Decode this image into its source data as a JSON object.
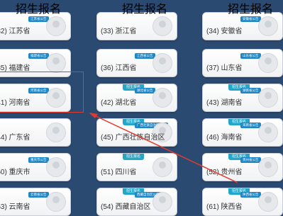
{
  "cards": [
    {
      "tag": "",
      "badge": "江苏省公告",
      "label": "(32) 江苏省"
    },
    {
      "tag": "",
      "badge": "",
      "label": "(33) 浙江省"
    },
    {
      "tag": "",
      "badge": "安徽省公告",
      "label": "(34) 安徽省"
    },
    {
      "tag": "",
      "badge": "福建省公告",
      "label": "(35) 福建省"
    },
    {
      "tag": "",
      "badge": "江西省公告",
      "label": "(36) 江西省"
    },
    {
      "tag": "",
      "badge": "山东省公告",
      "label": "(37) 山东省"
    },
    {
      "tag": "",
      "badge": "河南省公告",
      "label": "(41) 河南省"
    },
    {
      "tag": "招生报名",
      "badge": "湖北省公告",
      "label": "(42) 湖北省"
    },
    {
      "tag": "招生报名",
      "badge": "湖南省公告",
      "label": "(43) 湖南省"
    },
    {
      "tag": "",
      "badge": "",
      "label": "(44) 广东省"
    },
    {
      "tag": "招生报名",
      "badge": "广西壮族自治区公告",
      "label": "(45) 广西壮族自治区"
    },
    {
      "tag": "招生报名",
      "badge": "海南省公告",
      "label": "(46) 海南省"
    },
    {
      "tag": "",
      "badge": "重庆市公告",
      "label": "(50) 重庆市"
    },
    {
      "tag": "招生报名",
      "badge": "",
      "label": "(51) 四川省"
    },
    {
      "tag": "招生报名",
      "badge": "贵州省公告",
      "label": "(52) 贵州省"
    },
    {
      "tag": "",
      "badge": "云南省公告",
      "label": "(53) 云南省"
    },
    {
      "tag": "招生报名",
      "badge": "西藏自治区公告",
      "label": "(54) 西藏自治区"
    },
    {
      "tag": "招生报名",
      "badge": "陕西省公告",
      "label": "(61) 陕西省"
    }
  ],
  "top_tags": [
    "招生报名",
    "招生报名",
    "招生报名",
    "招生报名",
    "招生报名",
    "招生报名"
  ]
}
